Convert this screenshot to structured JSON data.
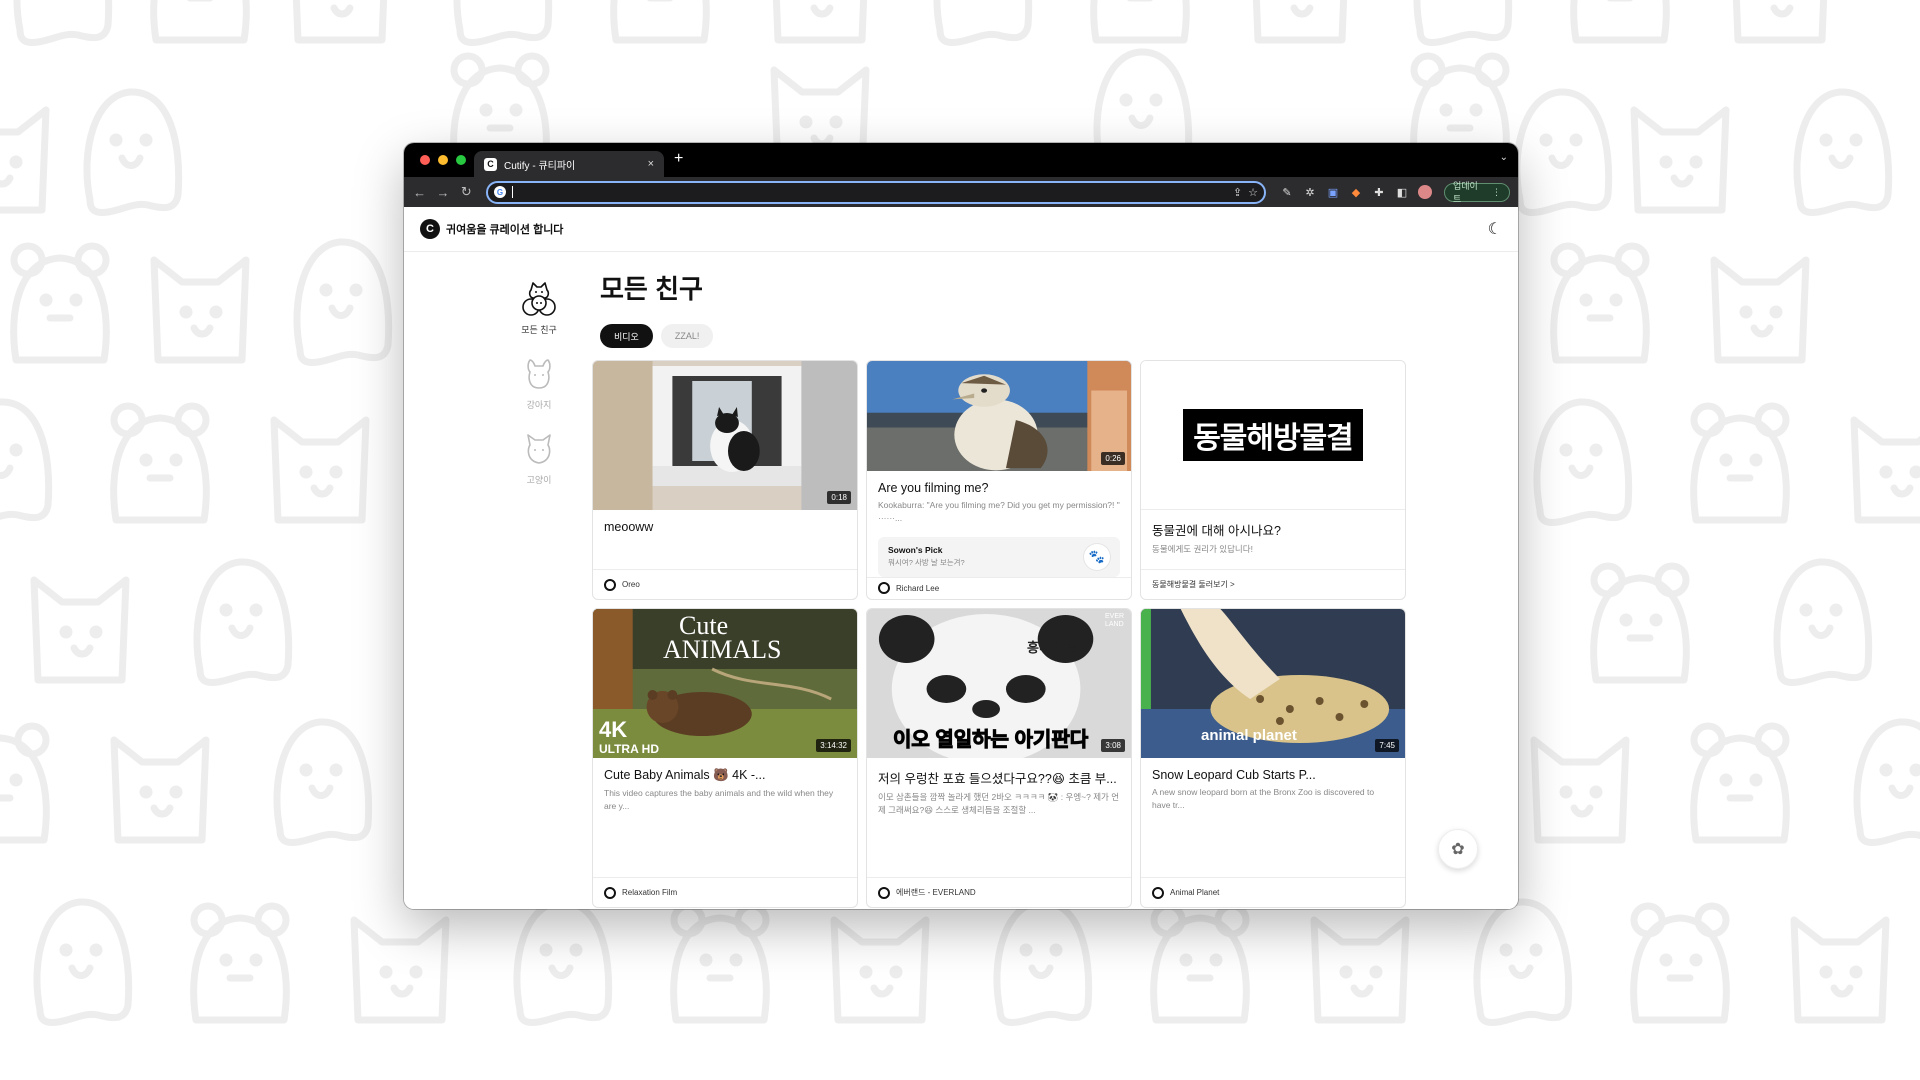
{
  "browser": {
    "tab_title": "Cutify - 큐티파이",
    "tab_favicon": "C",
    "new_tab": "+",
    "close": "×",
    "tab_list": "⌄",
    "omnibox_value": "",
    "update_label": "업데이트",
    "icons": {
      "back": "back-arrow-icon",
      "forward": "forward-arrow-icon",
      "reload": "reload-icon",
      "share": "share-icon",
      "bookmark": "star-icon",
      "extensions": "puzzle-icon"
    }
  },
  "app": {
    "logo_letter": "C",
    "tagline": "귀여움을 큐레이션 합니다",
    "theme_icon": "moon-icon"
  },
  "sidebar": {
    "items": [
      {
        "label": "모든 친구",
        "active": true
      },
      {
        "label": "강아지",
        "active": false
      },
      {
        "label": "고양이",
        "active": false
      }
    ]
  },
  "main": {
    "title": "모든 친구",
    "chips": [
      {
        "label": "비디오",
        "active": true
      },
      {
        "label": "ZZAL!",
        "active": false
      }
    ]
  },
  "cards": [
    {
      "title": "meooww",
      "desc": "",
      "duration": "0:18",
      "author": "Oreo"
    },
    {
      "title": "Are you filming me?",
      "desc": "Kookaburra: \"Are you filming me? Did you get my permission?! \" ······...",
      "duration": "0:26",
      "author": "Richard Lee",
      "pick_title": "Sowon's Pick",
      "pick_sub": "뭐시여? 사방 날 보는겨?"
    },
    {
      "title": "동물권에 대해 아시나요?",
      "desc": "동물에게도 권리가 있답니다!",
      "thumb_text": "동물해방물결",
      "link": "동물해방물결 둘러보기 >"
    },
    {
      "title": "Cute Baby Animals 🐻 4K -...",
      "desc": "This video captures the baby animals and the wild when they are y...",
      "duration": "3:14:32",
      "author": "Relaxation Film",
      "thumb_text_1": "Cute",
      "thumb_text_2": "Animals",
      "thumb_text_3": "4K",
      "thumb_text_4": "ULTRA HD"
    },
    {
      "title": "저의 우렁찬 포효 들으셨다구요??😆 초큼 부...",
      "desc": "이모 삼촌들을 깜짝 놀라게 했던 2바오 ㅋㅋㅋㅋ 🐼 : 우엥~? 제가 언제 그래써요?😆 스스로 생체리듬을 조절할 ...",
      "duration": "3:08",
      "author": "에버랜드 - EVERLAND",
      "thumb_text_1": "이오 열일하는 아기판다",
      "thumb_text_2": "흥냐 루울~",
      "thumb_text_3": "EVER LAND"
    },
    {
      "title": "Snow Leopard Cub Starts P...",
      "desc": "A new snow leopard born at the Bronx Zoo is discovered to have tr...",
      "duration": "7:45",
      "author": "Animal Planet",
      "thumb_text_1": "animal planet"
    }
  ],
  "fab_icon": "settings-icon"
}
